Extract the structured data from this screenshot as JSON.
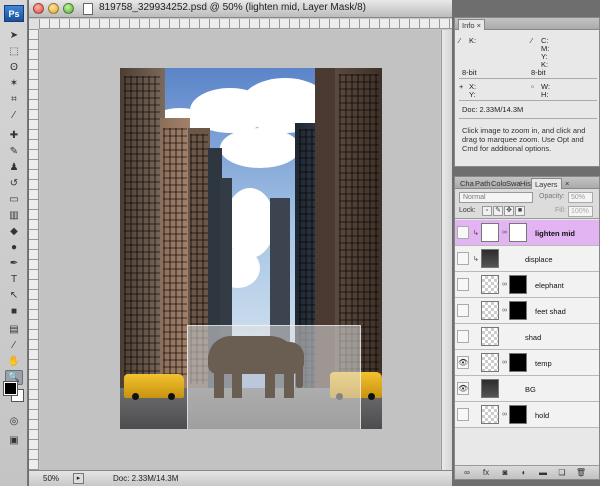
{
  "app": {
    "logo": "Ps"
  },
  "document": {
    "title": "819758_329934252.psd @ 50% (lighten mid, Layer Mask/8)",
    "zoom": "50%",
    "doc_size": "Doc: 2.33M/14.3M"
  },
  "tools": [
    {
      "name": "move-tool-icon",
      "glyph": "➤"
    },
    {
      "name": "marquee-tool-icon",
      "glyph": "⬚"
    },
    {
      "name": "lasso-tool-icon",
      "glyph": "ʘ"
    },
    {
      "name": "magic-wand-tool-icon",
      "glyph": "✶"
    },
    {
      "name": "crop-tool-icon",
      "glyph": "⌗"
    },
    {
      "name": "eyedropper-tool-icon",
      "glyph": "⁄"
    },
    {
      "name": "healing-brush-tool-icon",
      "glyph": "✚"
    },
    {
      "name": "brush-tool-icon",
      "glyph": "✎"
    },
    {
      "name": "clone-stamp-tool-icon",
      "glyph": "♟"
    },
    {
      "name": "history-brush-tool-icon",
      "glyph": "↺"
    },
    {
      "name": "eraser-tool-icon",
      "glyph": "▭"
    },
    {
      "name": "gradient-tool-icon",
      "glyph": "▥"
    },
    {
      "name": "blur-tool-icon",
      "glyph": "◆"
    },
    {
      "name": "dodge-tool-icon",
      "glyph": "●"
    },
    {
      "name": "pen-tool-icon",
      "glyph": "✒"
    },
    {
      "name": "type-tool-icon",
      "glyph": "T"
    },
    {
      "name": "path-selection-tool-icon",
      "glyph": "↖"
    },
    {
      "name": "shape-tool-icon",
      "glyph": "■"
    },
    {
      "name": "notes-tool-icon",
      "glyph": "▤"
    },
    {
      "name": "eyedropper2-tool-icon",
      "glyph": "⁄"
    },
    {
      "name": "hand-tool-icon",
      "glyph": "✋"
    },
    {
      "name": "zoom-tool-icon",
      "glyph": "🔍"
    }
  ],
  "info_panel": {
    "tab": "Info",
    "k_label": "K:",
    "c_label": "C:",
    "m_label": "M:",
    "y_label": "Y:",
    "k2_label": "K:",
    "bit_left": "8-bit",
    "bit_right": "8-bit",
    "x_label": "X:",
    "y2_label": "Y:",
    "w_label": "W:",
    "h_label": "H:",
    "doc": "Doc: 2.33M/14.3M",
    "help": "Click image to zoom in, and click and drag to marquee zoom. Use Opt and Cmd for additional options."
  },
  "layers_panel": {
    "tabs": [
      "Cha",
      "Path",
      "Colo",
      "Swa",
      "Hist",
      "Layers"
    ],
    "blend_mode": "Normal",
    "opacity_label": "Opacity:",
    "opacity_value": "50%",
    "lock_label": "Lock:",
    "fill_label": "Fill:",
    "fill_value": "100%",
    "layers": [
      {
        "name": "lighten mid",
        "selected": true,
        "visible": false,
        "bold": true
      },
      {
        "name": "displace",
        "selected": false,
        "visible": false,
        "bold": false
      },
      {
        "name": "elephant",
        "selected": false,
        "visible": false,
        "bold": false
      },
      {
        "name": "feet shad",
        "selected": false,
        "visible": false,
        "bold": false
      },
      {
        "name": "shad",
        "selected": false,
        "visible": false,
        "bold": false
      },
      {
        "name": "temp",
        "selected": false,
        "visible": true,
        "bold": false
      },
      {
        "name": "BG",
        "selected": false,
        "visible": true,
        "bold": false
      },
      {
        "name": "hold",
        "selected": false,
        "visible": false,
        "bold": false
      }
    ],
    "bottom_icons": [
      "link-icon",
      "fx-icon",
      "mask-icon",
      "adjustment-icon",
      "folder-icon",
      "new-layer-icon",
      "trash-icon"
    ]
  },
  "colors": {
    "selected_layer": "#e2b4f2",
    "foreground": "#000000",
    "background": "#ffffff"
  }
}
